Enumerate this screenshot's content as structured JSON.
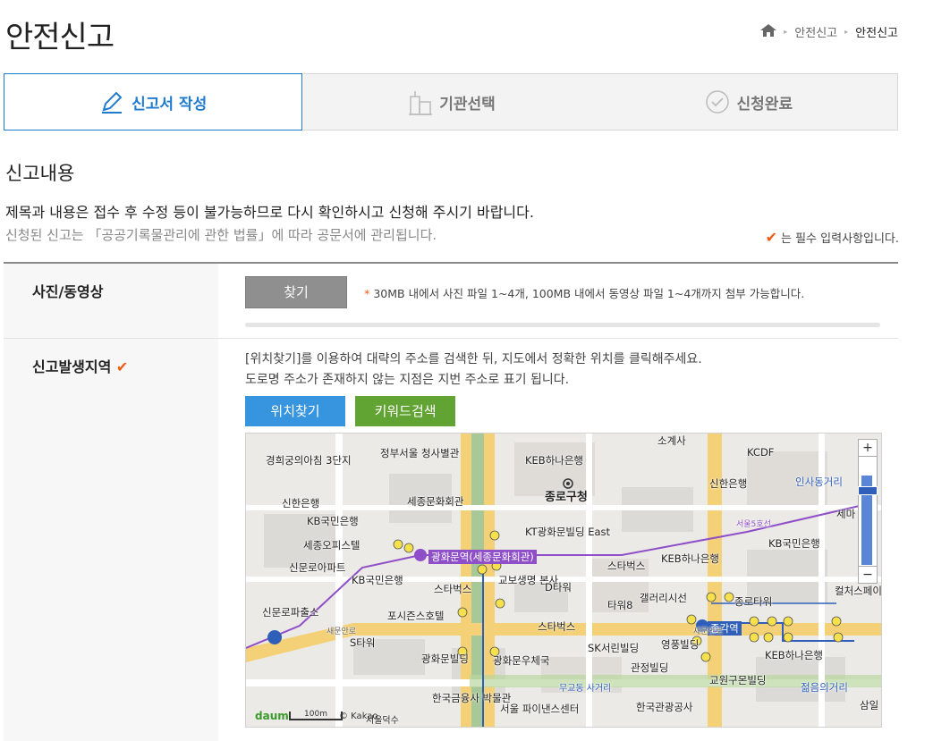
{
  "page": {
    "title": "안전신고"
  },
  "breadcrumb": {
    "icon": "home-icon",
    "item1": "안전신고",
    "item2": "안전신고"
  },
  "steps": [
    {
      "label": "신고서 작성",
      "icon": "pencil-icon",
      "active": true
    },
    {
      "label": "기관선택",
      "icon": "building-icon",
      "active": false
    },
    {
      "label": "신청완료",
      "icon": "check-circle-icon",
      "active": false
    }
  ],
  "section": {
    "title": "신고내용",
    "notice1": "제목과 내용은 접수 후 수정 등이 불가능하므로 다시 확인하시고 신청해 주시기 바랍니다.",
    "notice2": "신청된 신고는 「공공기록물관리에 관한 법률」에 따라 공문서에 관리됩니다.",
    "required_note": "는 필수 입력사항입니다."
  },
  "photo_row": {
    "label": "사진/동영상",
    "button": "찾기",
    "hint_star": "*",
    "hint": "30MB 내에서 사진 파일 1~4개, 100MB 내에서 동영상 파일 1~4개까지 첨부 가능합니다.",
    "progress": 0
  },
  "location_row": {
    "label": "신고발생지역",
    "desc1": "[위치찾기]를 이용하여 대략의 주소를 검색한 뒤, 지도에서 정확한 위치를 클릭해주세요.",
    "desc2": "도로명 주소가 존재하지 않는 지점은 지번 주소로 표기 됩니다.",
    "btn_location": "위치찾기",
    "btn_keyword": "키워드검색"
  },
  "map": {
    "labels": {
      "l1": "경희궁의아침 3단지",
      "l2": "정부서울 청사별관",
      "l3": "KEB하나은행",
      "l4": "KCDF",
      "l5": "신한은행",
      "l6": "인사동거리",
      "l7": "세종문화회관",
      "l8": "종로구청",
      "l9": "신한은행",
      "l10": "KB국민은행",
      "l11": "세종오피스텔",
      "l12": "KT광화문빌딩 East",
      "l13": "광화문역(세종문화회관)",
      "l14": "KEB하나은행",
      "l15": "KB국민은행",
      "l16": "신문로아파트",
      "l17": "KB국민은행",
      "l18": "스타벅스",
      "l19": "교보생명 본사",
      "l20": "스타벅스",
      "l21": "D타워",
      "l22": "갤러리시선",
      "l23": "타워8",
      "l24": "신문로파출소",
      "l25": "포시즌스호텔",
      "l26": "S타워",
      "l27": "스타벅스",
      "l28": "종각역",
      "l29": "광화문빌딩",
      "l30": "광화문우체국",
      "l31": "SK서린빌딩",
      "l32": "영풍빌딩",
      "l33": "관정빌딩",
      "l34": "KEB하나은행",
      "l35": "교원구몬빌딩",
      "l36": "젊음의거리",
      "l37": "한국금융사 박물관",
      "l38": "서울 파이낸스센터",
      "l39": "한국관광공사",
      "l40": "서울5호선",
      "l41": "무교동 사거리",
      "l42": "새문안로",
      "l43": "종로타워",
      "l44": "삼일",
      "l45": "컬처스페이",
      "l46": "세마",
      "l47": "소계사",
      "l48": "서울덕수",
      "l49": "새문안로"
    },
    "scale": "100m",
    "copyright": "© Kakao",
    "brand": "daum",
    "zoom_in": "+",
    "zoom_out": "−"
  },
  "colors": {
    "accent": "#1e7bd0",
    "required": "#f05a14",
    "btn_blue": "#3795e0",
    "btn_green": "#62a433"
  }
}
